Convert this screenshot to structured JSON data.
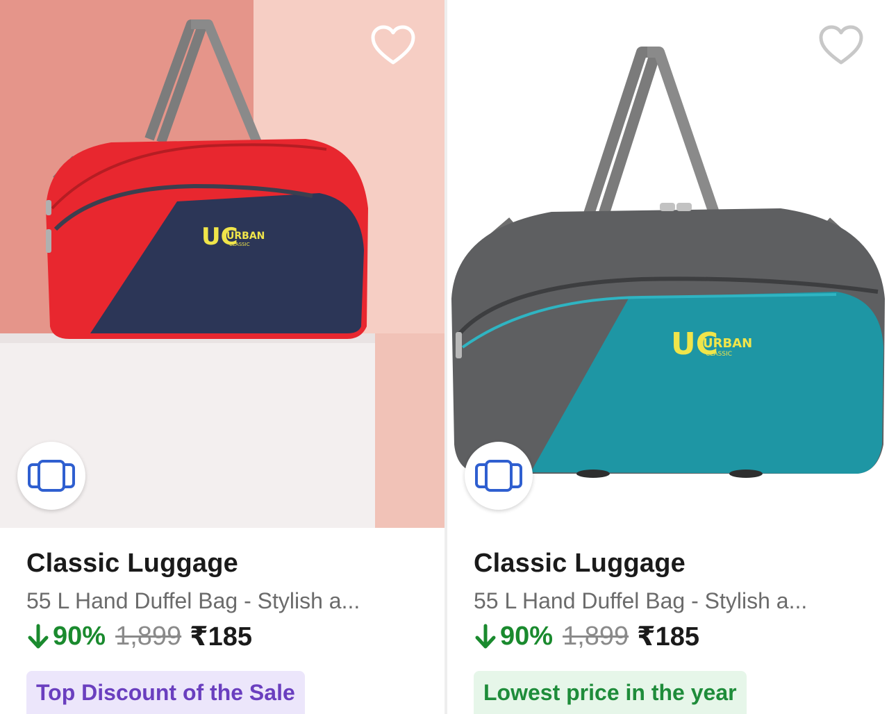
{
  "products": [
    {
      "brand": "Classic Luggage",
      "description": "55 L Hand Duffel Bag - Stylish a...",
      "discount": "90%",
      "mrp": "1,899",
      "price": "₹185",
      "tag": "Top Discount of the Sale",
      "logo_text": "URBAN",
      "logo_sub": "CLASSIC",
      "colors": {
        "body": "#e8272f",
        "panel": "#2c3657",
        "accent": "#f0e54a"
      }
    },
    {
      "brand": "Classic Luggage",
      "description": "55 L Hand Duffel Bag - Stylish a...",
      "discount": "90%",
      "mrp": "1,899",
      "price": "₹185",
      "tag": "Lowest price in the year",
      "logo_text": "URBAN",
      "logo_sub": "CLASSIC",
      "colors": {
        "body": "#5e5f61",
        "panel": "#1e96a4",
        "accent": "#f0e54a"
      }
    }
  ],
  "icons": {
    "wishlist": "heart-outline-icon",
    "similar": "stacked-cards-icon",
    "discount_arrow": "arrow-down-icon"
  },
  "theme": {
    "discount_green": "#1a8a2e",
    "tag_purple_bg": "#ece6fb",
    "tag_purple_text": "#6a3fbf",
    "tag_green_bg": "#e6f6e9",
    "tag_green_text": "#1e8c3a"
  }
}
